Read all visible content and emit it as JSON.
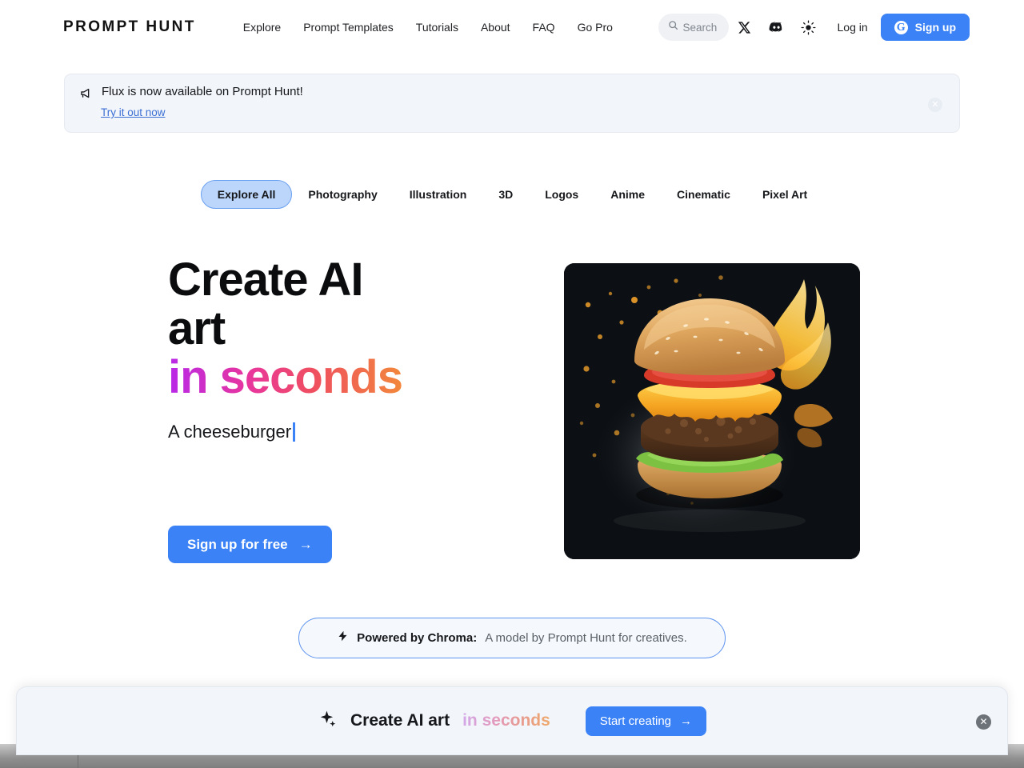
{
  "header": {
    "brand": "PROMPT HUNT",
    "nav": [
      {
        "label": "Explore",
        "name": "nav-explore"
      },
      {
        "label": "Prompt Templates",
        "name": "nav-prompt-templates"
      },
      {
        "label": "Tutorials",
        "name": "nav-tutorials"
      },
      {
        "label": "About",
        "name": "nav-about"
      },
      {
        "label": "FAQ",
        "name": "nav-faq"
      },
      {
        "label": "Go Pro",
        "name": "nav-go-pro"
      }
    ],
    "search": {
      "placeholder": "Search",
      "value": "",
      "icon": "search-icon"
    },
    "icons": [
      {
        "name": "x-twitter-icon"
      },
      {
        "name": "discord-icon"
      },
      {
        "name": "theme-toggle-sun-icon"
      }
    ],
    "login_label": "Log in",
    "signup_label": "Sign up",
    "signup_provider_glyph": "G",
    "accent_color": "#3b82f6"
  },
  "banner": {
    "icon": "megaphone-icon",
    "title": "Flux is now available on Prompt Hunt!",
    "link_label": "Try it out now",
    "close_glyph": "✕",
    "bg_color": "#f2f5f9",
    "link_color": "#3b6fd4"
  },
  "tabs": {
    "items": [
      {
        "label": "Explore All",
        "active": true
      },
      {
        "label": "Photography",
        "active": false
      },
      {
        "label": "Illustration",
        "active": false
      },
      {
        "label": "3D",
        "active": false
      },
      {
        "label": "Logos",
        "active": false
      },
      {
        "label": "Anime",
        "active": false
      },
      {
        "label": "Cinematic",
        "active": false
      },
      {
        "label": "Pixel Art",
        "active": false
      }
    ],
    "active_bg": "#bcd6fb",
    "active_border": "#6aa0f0"
  },
  "hero": {
    "headline_line1": "Create AI",
    "headline_line2": "art",
    "headline_gradient": "in seconds",
    "gradient_from": "#b829e8",
    "gradient_mid": "#e8359e",
    "gradient_to": "#f2883c",
    "prompt_text": "A cheeseburger",
    "cursor_color": "#3b82f6",
    "cta_label": "Sign up for free",
    "cta_arrow": "→",
    "image_alt": "flaming-cheeseburger-ai-art"
  },
  "chroma": {
    "icon": "lightning-bolt-icon",
    "bold_text": "Powered by Chroma:",
    "sub_text": "A model by Prompt Hunt for creatives.",
    "border_color": "#5c93ef"
  },
  "bottom_bar": {
    "icon": "sparkles-icon",
    "text": "Create AI art",
    "gradient_text": "in seconds",
    "button_label": "Start creating",
    "button_arrow": "→",
    "close_glyph": "✕"
  }
}
